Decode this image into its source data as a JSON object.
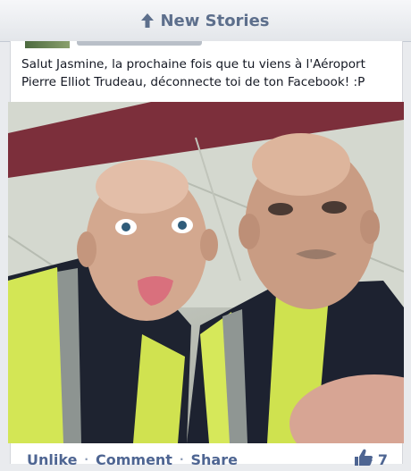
{
  "banner": {
    "label": "New Stories",
    "icon": "up-arrow-icon"
  },
  "post": {
    "text": "Salut Jasmine, la prochaine fois que tu viens à l'Aéroport Pierre Elliot Trudeau, déconnecte toi de ton Facebook! :P",
    "photo": "selfie-photo"
  },
  "actions": {
    "unlike": "Unlike",
    "separator": "·",
    "comment": "Comment",
    "share": "Share",
    "like_icon": "thumbs-up-icon",
    "like_count": "7"
  },
  "colors": {
    "link": "#4e6592",
    "banner_text": "#5d6f8c",
    "background": "#e9ebee"
  }
}
